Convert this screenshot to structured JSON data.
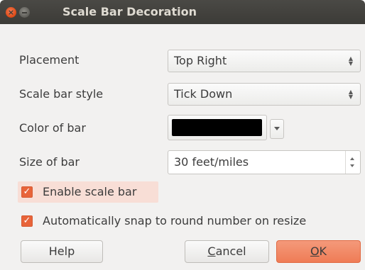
{
  "window": {
    "title": "Scale Bar Decoration",
    "close_icon": "×"
  },
  "form": {
    "placement": {
      "label": "Placement",
      "value": "Top Right"
    },
    "style": {
      "label": "Scale bar style",
      "value": "Tick Down"
    },
    "color": {
      "label": "Color of bar",
      "value": "#000000"
    },
    "size": {
      "label": "Size of bar",
      "value": "30 feet/miles"
    },
    "enable": {
      "label": "Enable scale bar",
      "checked": true
    },
    "snap": {
      "label": "Automatically snap to round number on resize",
      "checked": true
    }
  },
  "buttons": {
    "help": "Help",
    "cancel_mnemonic": "C",
    "cancel_rest": "ancel",
    "ok_mnemonic": "O",
    "ok_rest": "K"
  },
  "colors": {
    "accent": "#ef7c56",
    "titlebar": "#3c3b37"
  }
}
